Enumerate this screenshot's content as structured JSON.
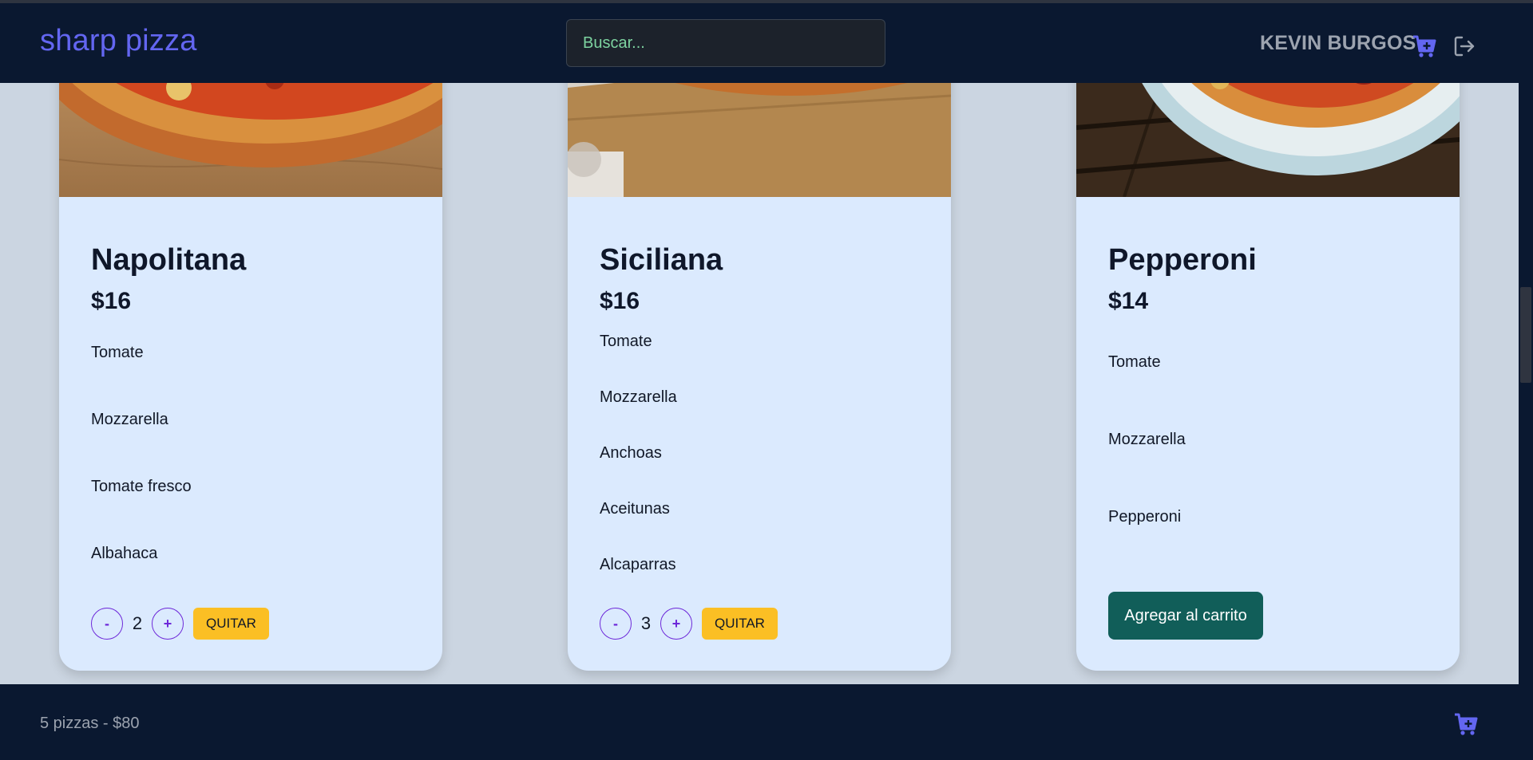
{
  "header": {
    "brand": "sharp pizza",
    "search_placeholder": "Buscar...",
    "user_name": "KEVIN BURGOS"
  },
  "cards": [
    {
      "name": "Napolitana",
      "price": "$16",
      "ingredients": [
        "Tomate",
        "Mozzarella",
        "Tomate fresco",
        "Albahaca"
      ],
      "in_cart": true,
      "quantity": "2",
      "minus_label": "-",
      "plus_label": "+",
      "remove_label": "QUITAR"
    },
    {
      "name": "Siciliana",
      "price": "$16",
      "ingredients": [
        "Tomate",
        "Mozzarella",
        "Anchoas",
        "Aceitunas",
        "Alcaparras"
      ],
      "in_cart": true,
      "quantity": "3",
      "minus_label": "-",
      "plus_label": "+",
      "remove_label": "QUITAR"
    },
    {
      "name": "Pepperoni",
      "price": "$14",
      "ingredients": [
        "Tomate",
        "Mozzarella",
        "Pepperoni"
      ],
      "in_cart": false,
      "add_label": "Agregar al carrito"
    }
  ],
  "footer": {
    "summary": "5 pizzas -  $80"
  },
  "colors": {
    "brand": "#6366f1",
    "header_bg": "#0a1830",
    "card_bg": "#dbeafe",
    "page_bg": "#cbd5e1",
    "remove_button": "#fbbf24",
    "add_button": "#115e59",
    "search_text": "#7dd3a0"
  },
  "icons": [
    "cart-plus-icon",
    "logout-icon"
  ]
}
